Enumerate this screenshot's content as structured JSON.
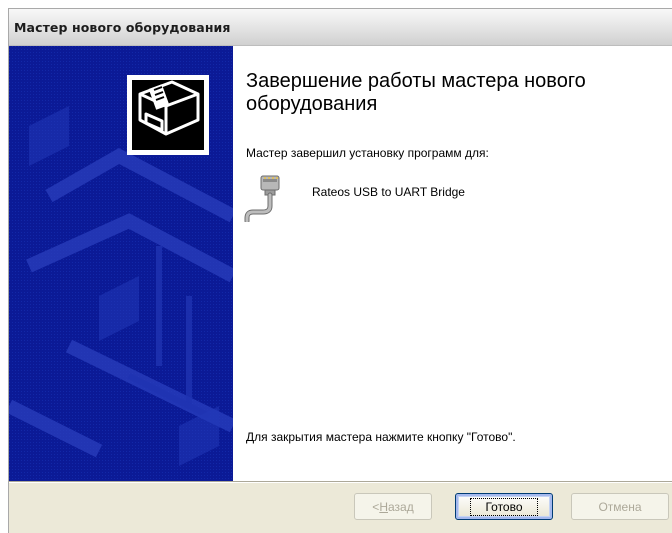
{
  "window": {
    "title": "Мастер нового оборудования"
  },
  "main": {
    "heading": "Завершение работы мастера нового оборудования",
    "subtext": "Мастер завершил установку программ для:",
    "device": {
      "icon": "serial-cable-icon",
      "name": "Rateos USB to UART Bridge"
    },
    "finish_text": "Для закрытия мастера нажмите кнопку \"Готово\"."
  },
  "buttons": {
    "back_underlined": "Н",
    "back_rest": "азад",
    "back_prefix": "< ",
    "finish": "Готово",
    "cancel": "Отмена",
    "back_enabled": false,
    "cancel_enabled": false
  },
  "sidebar": {
    "icon": "hardware-wizard-icon",
    "color": "#0b1a96"
  }
}
